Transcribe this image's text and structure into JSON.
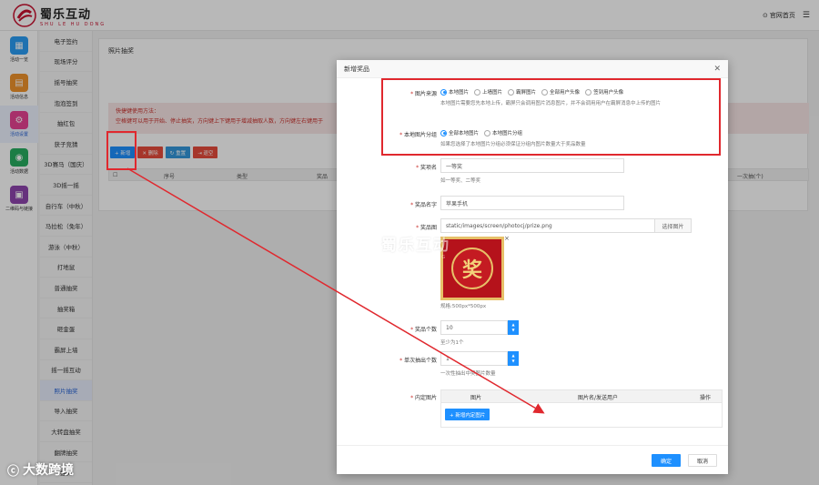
{
  "brand": {
    "name_cn": "蜀乐互动",
    "name_en": "SHU LE HU DONG",
    "color": "#c8102e"
  },
  "top_right": {
    "home_label": "官网首页",
    "home_icon": "home-icon"
  },
  "iconbar": [
    {
      "label": "活动一览",
      "icon": "grid-icon",
      "color": "#2a9df4"
    },
    {
      "label": "活动信息",
      "icon": "document-icon",
      "color": "#f0932b"
    },
    {
      "label": "活动设置",
      "icon": "gear-icon",
      "color": "#e84393",
      "active": true
    },
    {
      "label": "活动数据",
      "icon": "database-icon",
      "color": "#27ae60"
    },
    {
      "label": "二维码与链接",
      "icon": "link-icon",
      "color": "#8e44ad"
    }
  ],
  "subnav": [
    "电子签约",
    "现场评分",
    "摇号抽奖",
    "泡泡签到",
    "抽红包",
    "获子竞猜",
    "3D赛马（国庆）",
    "3D摇一摇",
    "自行车（中秋）",
    "马拉松（免年）",
    "游泳（中秋）",
    "打地鼠",
    "普通抽奖",
    "抽奖箱",
    "砸金蛋",
    "霸屏上墙",
    "摇一摇互动",
    "照片抽奖",
    "导入抽奖",
    "大转盘抽奖",
    "翻牌抽奖",
    "抽奖"
  ],
  "panel": {
    "title": "照片抽奖",
    "tips_title": "快捷键使用方法：",
    "tips_line": "空格键可以用于开始、停止抽奖，方向键上下键用于增减抽取人数，方向键左右键用于",
    "toolbar": {
      "add": "+ 新增",
      "delete": "✕ 删除",
      "reset": "↻ 重置",
      "export": "⇥ 退空"
    },
    "columns": [
      "序号",
      "类型",
      "奖品",
      "一次抽(个)"
    ]
  },
  "modal": {
    "title": "新增奖品",
    "image_source": {
      "label": "图片来源",
      "options": [
        "本地图片",
        "上墙图片",
        "霸屏图片",
        "全部用户头像",
        "签到用户头像"
      ],
      "selected": "本地图片",
      "hint": "本地图片需要您先本地上传，霸屏只会调用图片消息图片，并不会调用用户在霸屏消息中上传的图片"
    },
    "local_group": {
      "label": "本地图片分组",
      "options": [
        "全部本地图片",
        "本地图片分组"
      ],
      "selected": "全部本地图片",
      "hint": "如果您选择了本地图片分组必须保证分组内图片数量大于奖品数量"
    },
    "prize_level": {
      "label": "奖项名",
      "value": "一等奖",
      "hint": "如一等奖、二等奖"
    },
    "prize_name": {
      "label": "奖品名字",
      "value": "苹果手机"
    },
    "prize_image": {
      "label": "奖品图",
      "path": "static/images/screen/photocj/prize.png",
      "choose_btn": "选择图片",
      "image_char": "奖",
      "size_hint": "规格:500px*500px",
      "remove": "×"
    },
    "prize_count": {
      "label": "奖品个数",
      "value": "10",
      "hint": "至少为1个"
    },
    "per_draw": {
      "label": "单次抽出个数",
      "value": "1",
      "hint": "一次性抽出中奖图片数量"
    },
    "fixed_images": {
      "label": "内定图片",
      "columns": [
        "图片",
        "图片名/发送用户",
        "操作"
      ],
      "add_btn": "+ 新增内定图片"
    },
    "confirm": "确定",
    "cancel": "取消"
  },
  "watermark": {
    "cn": "蜀乐互动",
    "en": "SHU LE HU DONG"
  },
  "corner_watermark": "大数跨境"
}
